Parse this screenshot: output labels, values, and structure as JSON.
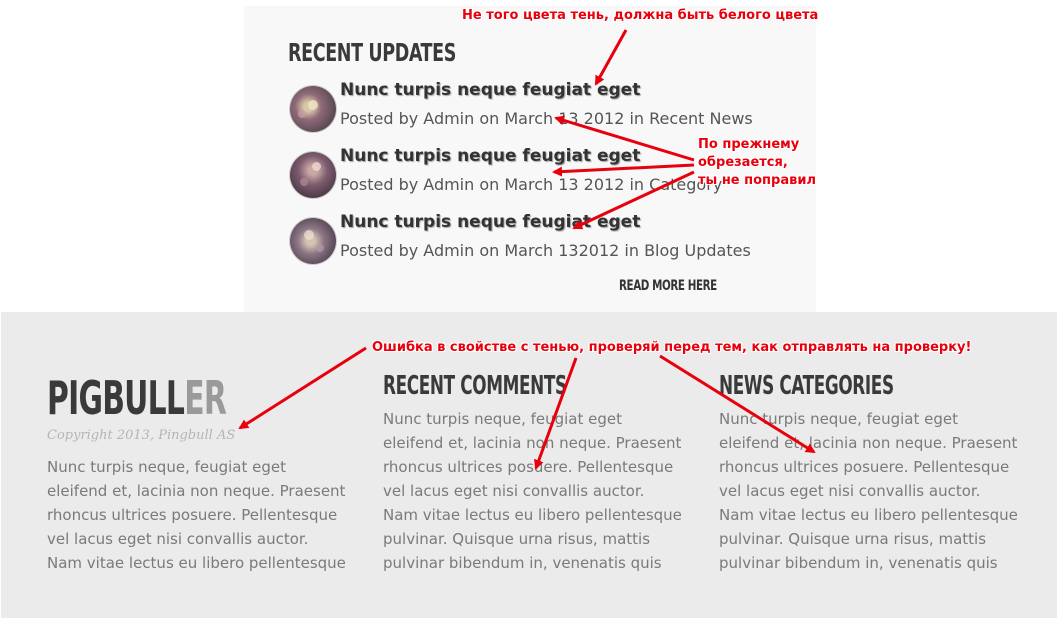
{
  "recent_updates": {
    "title": "RECENT UPDATES",
    "items": [
      {
        "title": "Nunc turpis neque feugiat eget",
        "meta": "Posted by Admin on March 13 2012 in Recent News"
      },
      {
        "title": "Nunc turpis neque feugiat eget",
        "meta": "Posted by Admin on March 13 2012 in Category"
      },
      {
        "title": "Nunc turpis neque feugiat eget",
        "meta": "Posted by Admin on March 132012 in Blog Updates"
      }
    ],
    "read_more": "READ MORE HERE"
  },
  "annotations": {
    "shadow_color": "Не того цвета тень, должна быть белого цвета",
    "clipped_line1": "По прежнему",
    "clipped_line2": "обрезается,",
    "clipped_line3": "ты не поправил",
    "shadow_error": "Ошибка в свойстве с тенью, проверяй перед тем, как отправлять на проверку!"
  },
  "footer": {
    "logo_dark": "PIGBULL",
    "logo_light": "ER",
    "copyright": "Copyright 2013, Pingbull AS",
    "about_text": "Nunc turpis neque, feugiat eget eleifend et, lacinia non neque. Praesent rhoncus ultrices posuere. Pellentesque vel lacus eget nisi convallis auctor. Nam vitae lectus eu libero pellentesque",
    "comments_title": "RECENT COMMENTS",
    "comments_text": "Nunc turpis neque, feugiat eget eleifend et, lacinia non neque. Praesent rhoncus ultrices posuere. Pellentesque vel lacus eget nisi convallis auctor. Nam vitae lectus eu libero pellentesque pulvinar. Quisque urna risus, mattis pulvinar bibendum in, venenatis quis",
    "categories_title": "NEWS CATEGORIES",
    "categories_text": "Nunc turpis neque, feugiat eget eleifend et, lacinia non neque. Praesent rhoncus ultrices posuere. Pellentesque vel lacus eget nisi convallis auctor. Nam vitae lectus eu libero pellentesque pulvinar. Quisque urna risus, mattis pulvinar bibendum in, venenatis quis"
  },
  "colors": {
    "annotation": "#e8000c",
    "footer_bg": "#ebebeb",
    "panel_bg": "#f8f8f8"
  }
}
